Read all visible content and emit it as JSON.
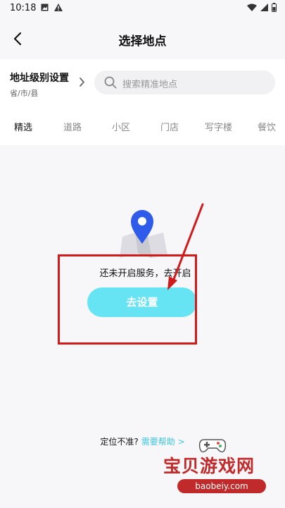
{
  "status_bar": {
    "time": "10:18"
  },
  "header": {
    "title": "选择地点"
  },
  "address_level": {
    "title": "地址级别设置",
    "subtitle": "省/市/县"
  },
  "search": {
    "placeholder": "搜索精准地点"
  },
  "tabs": [
    {
      "label": "精选",
      "active": true
    },
    {
      "label": "道路"
    },
    {
      "label": "小区"
    },
    {
      "label": "门店"
    },
    {
      "label": "写字楼"
    },
    {
      "label": "餐饮"
    }
  ],
  "empty_state": {
    "message": "还未开启服务，去开启",
    "button_label": "去设置"
  },
  "help": {
    "question": "定位不准?",
    "link": "需要帮助 >"
  },
  "watermark": {
    "title": "宝贝游戏网",
    "url": "baobeiy.com"
  },
  "colors": {
    "accent": "#66e4f4",
    "link": "#3ec5dc",
    "pin": "#2f5bea",
    "annotation": "#d11a1a"
  }
}
